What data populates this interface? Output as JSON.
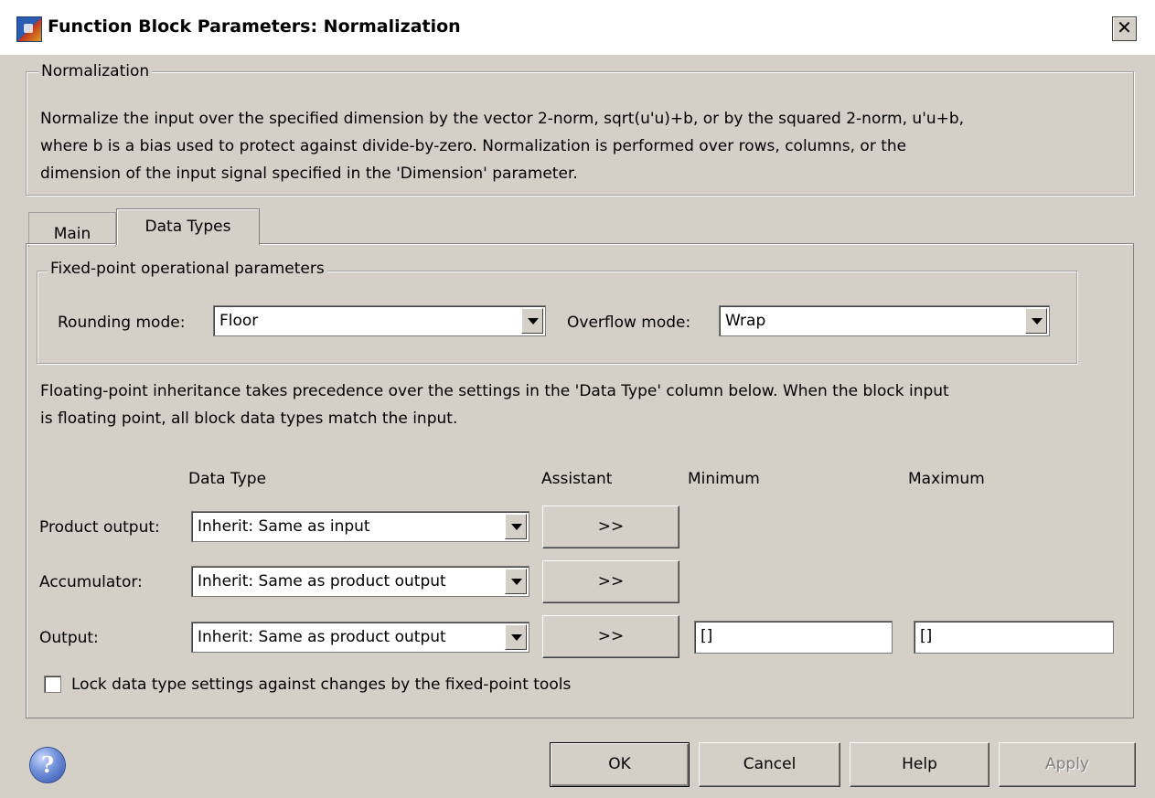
{
  "window": {
    "title": "Function Block Parameters: Normalization",
    "close_glyph": "✕"
  },
  "description_group": {
    "legend": "Normalization",
    "lines": [
      "Normalize the input over the specified dimension by the vector 2-norm, sqrt(u'u)+b, or by the squared 2-norm, u'u+b,",
      "where b is a bias used to protect against divide-by-zero.  Normalization is performed over rows, columns, or the",
      "dimension of the input signal specified in the 'Dimension' parameter."
    ]
  },
  "tabs": [
    {
      "label": "Main",
      "selected": false
    },
    {
      "label": "Data Types",
      "selected": true
    }
  ],
  "fixed_point_group": {
    "legend": "Fixed-point operational parameters",
    "rounding_label": "Rounding mode:",
    "rounding_value": "Floor",
    "overflow_label": "Overflow mode:",
    "overflow_value": "Wrap"
  },
  "inheritance_note": [
    "Floating-point inheritance takes precedence over the settings in the 'Data Type' column below. When the block input",
    "is floating point, all block data types match the input."
  ],
  "table": {
    "headers": {
      "data_type": "Data Type",
      "assistant": "Assistant",
      "minimum": "Minimum",
      "maximum": "Maximum"
    },
    "rows": [
      {
        "label": "Product output:",
        "data_type": "Inherit: Same as input",
        "assistant": ">>"
      },
      {
        "label": "Accumulator:",
        "data_type": "Inherit: Same as product output",
        "assistant": ">>"
      },
      {
        "label": "Output:",
        "data_type": "Inherit: Same as product output",
        "assistant": ">>",
        "minimum": "[]",
        "maximum": "[]"
      }
    ]
  },
  "lock_checkbox": {
    "label": "Lock data type settings against changes by the fixed-point tools",
    "checked": false
  },
  "footer": {
    "help_icon": "question-mark-icon",
    "help_glyph": "?",
    "ok": "OK",
    "cancel": "Cancel",
    "help": "Help",
    "apply": "Apply"
  }
}
